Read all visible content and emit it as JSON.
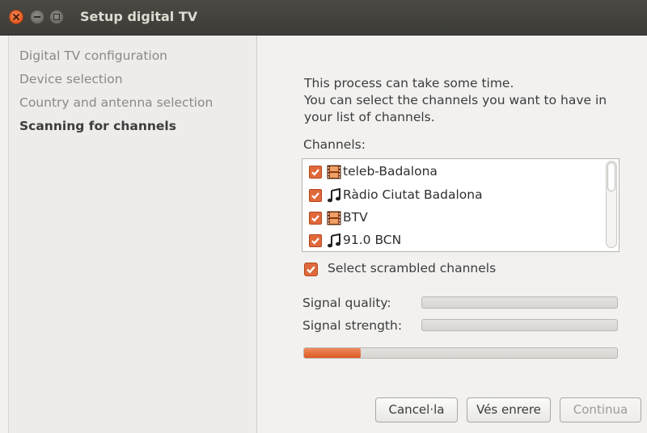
{
  "window": {
    "title": "Setup digital TV"
  },
  "sidebar": {
    "steps": [
      {
        "label": "Digital TV configuration"
      },
      {
        "label": "Device selection"
      },
      {
        "label": "Country and antenna selection"
      },
      {
        "label": "Scanning for channels"
      }
    ]
  },
  "main": {
    "description_lines": [
      "This process can take some time.",
      "You can select the channels you want to have in",
      "your list of channels."
    ],
    "channels_label": "Channels:",
    "channels": [
      {
        "name": "teleb-Badalona",
        "type_icon": "tv-icon",
        "checked": true
      },
      {
        "name": "Ràdio Ciutat Badalona",
        "type_icon": "radio-icon",
        "checked": true
      },
      {
        "name": "BTV",
        "type_icon": "tv-icon",
        "checked": true
      },
      {
        "name": "91.0 BCN",
        "type_icon": "radio-icon",
        "checked": true
      }
    ],
    "scrambled_label": "Select scrambled channels",
    "scrambled_checked": true,
    "signal_quality_label": "Signal quality:",
    "signal_quality_value": 0,
    "signal_strength_label": "Signal strength:",
    "signal_strength_value": 0,
    "scan_progress": 0.18
  },
  "buttons": {
    "cancel": "Cancel·la",
    "back": "Vés enrere",
    "continue": "Continua"
  },
  "colors": {
    "accent": "#e0693c",
    "titlebar": "#3f3e3a"
  }
}
